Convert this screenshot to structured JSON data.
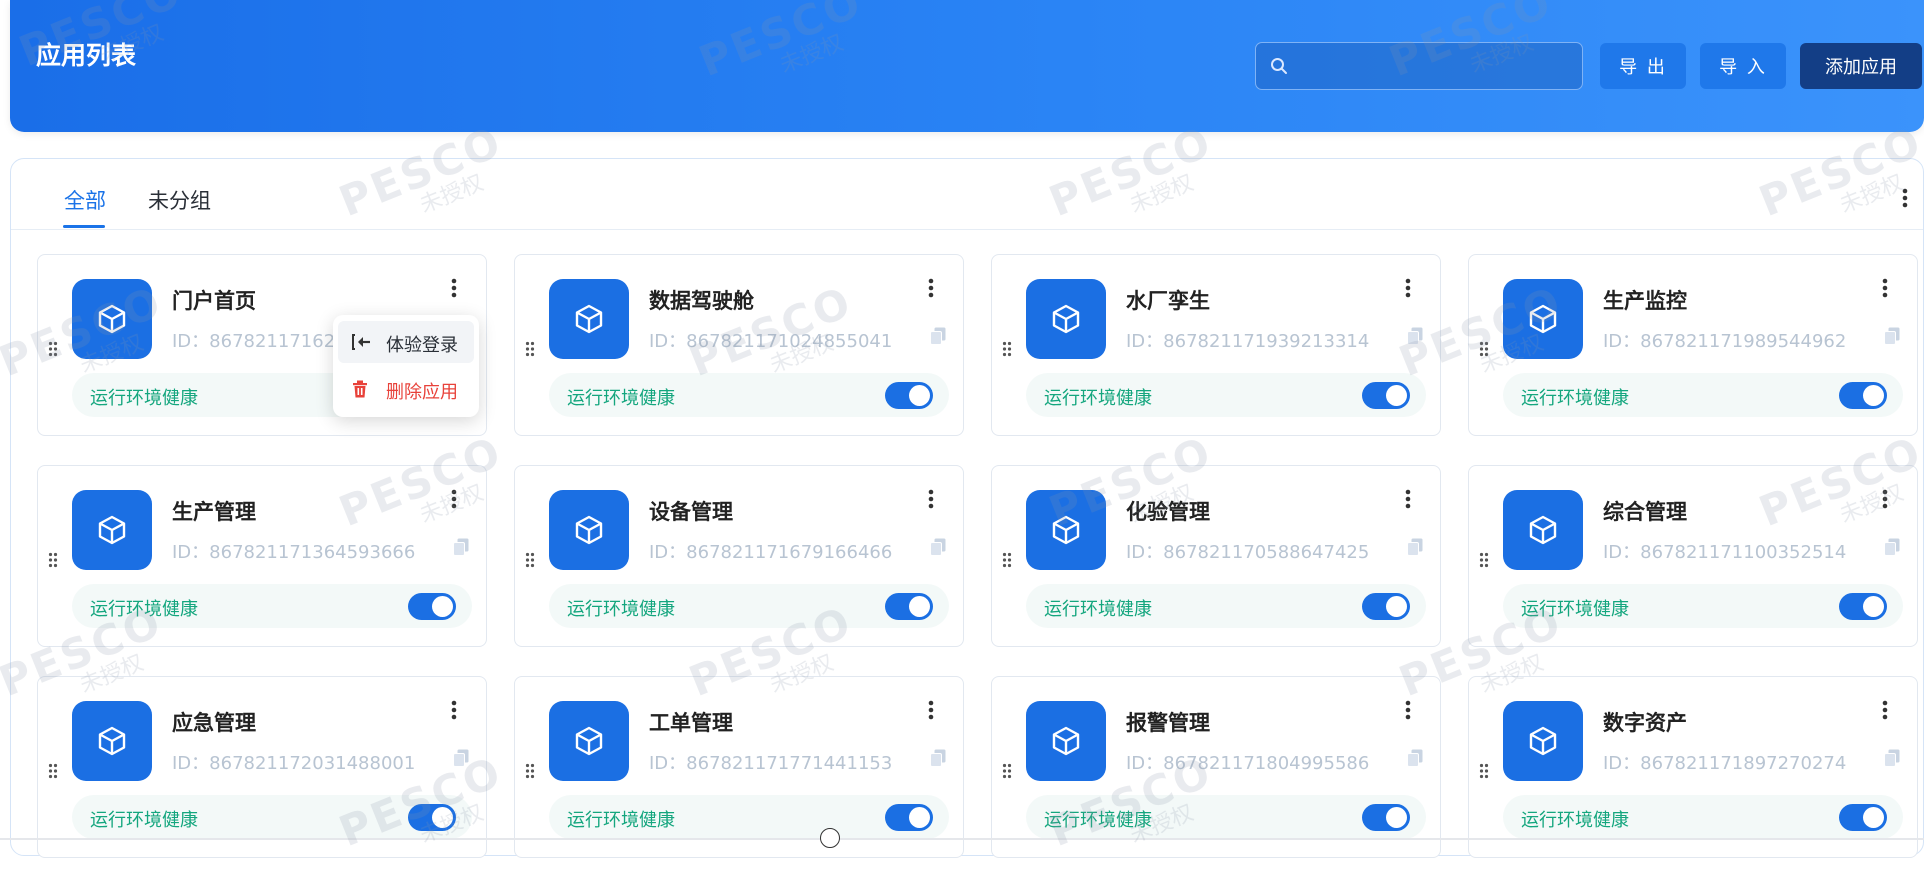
{
  "header": {
    "title": "应用列表",
    "search_placeholder": "",
    "export_label": "导 出",
    "import_label": "导 入",
    "add_label": "添加应用"
  },
  "tabs": [
    {
      "label": "全部",
      "active": true
    },
    {
      "label": "未分组",
      "active": false
    }
  ],
  "colors": {
    "primary": "#1b6fe3",
    "status_green": "#14a67e",
    "danger": "#e8423a"
  },
  "cards": [
    {
      "name": "门户首页",
      "id": "ID：867821171624",
      "status": "运行环境健康",
      "enabled": true
    },
    {
      "name": "数据驾驶舱",
      "id": "ID：867821171024855041",
      "status": "运行环境健康",
      "enabled": true
    },
    {
      "name": "水厂孪生",
      "id": "ID：867821171939213314",
      "status": "运行环境健康",
      "enabled": true
    },
    {
      "name": "生产监控",
      "id": "ID：867821171989544962",
      "status": "运行环境健康",
      "enabled": true
    },
    {
      "name": "生产管理",
      "id": "ID：867821171364593666",
      "status": "运行环境健康",
      "enabled": true
    },
    {
      "name": "设备管理",
      "id": "ID：867821171679166466",
      "status": "运行环境健康",
      "enabled": true
    },
    {
      "name": "化验管理",
      "id": "ID：867821170588647425",
      "status": "运行环境健康",
      "enabled": true
    },
    {
      "name": "综合管理",
      "id": "ID：867821171100352514",
      "status": "运行环境健康",
      "enabled": true
    },
    {
      "name": "应急管理",
      "id": "ID：867821172031488001",
      "status": "运行环境健康",
      "enabled": true
    },
    {
      "name": "工单管理",
      "id": "ID：867821171771441153",
      "status": "运行环境健康",
      "enabled": true
    },
    {
      "name": "报警管理",
      "id": "ID：867821171804995586",
      "status": "运行环境健康",
      "enabled": true
    },
    {
      "name": "数字资产",
      "id": "ID：867821171897270274",
      "status": "运行环境健康",
      "enabled": true
    }
  ],
  "context_menu": {
    "items": [
      {
        "label": "体验登录",
        "icon": "login-icon"
      },
      {
        "label": "删除应用",
        "icon": "trash-icon"
      }
    ]
  },
  "watermark": {
    "brand": "PESCO",
    "note": "未授权"
  }
}
